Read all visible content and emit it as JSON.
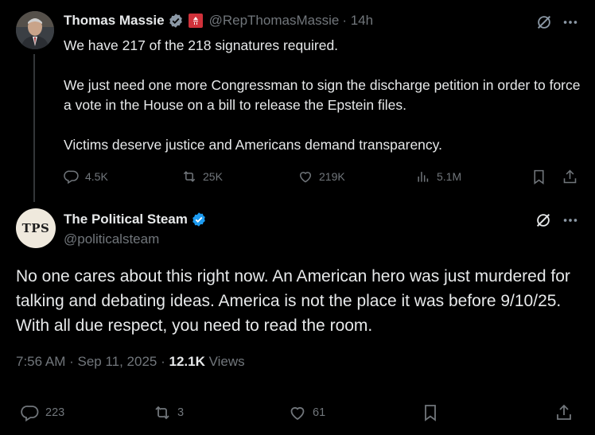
{
  "parent": {
    "display_name": "Thomas Massie",
    "handle": "@RepThomasMassie",
    "time": "· 14h",
    "paragraphs": [
      "We have 217 of the 218 signatures required.",
      "We just need one more Congressman to sign the discharge petition in order to force a vote in the House on a bill to release the Epstein files.",
      "Victims deserve justice and Americans demand transparency."
    ],
    "stats": {
      "replies": "4.5K",
      "reposts": "25K",
      "likes": "219K",
      "views": "5.1M"
    }
  },
  "reply": {
    "avatar_text": "TPS",
    "display_name": "The Political Steam",
    "handle": "@politicalsteam",
    "text": "No one cares about this right now. An American hero was just murdered for talking and debating ideas. America is not the place it was before 9/10/25. With all due respect, you need to read the room.",
    "timestamp": "7:56 AM · Sep 11, 2025 ·",
    "views_count": "12.1K",
    "views_label": "Views",
    "stats": {
      "replies": "223",
      "reposts": "3",
      "likes": "61"
    }
  },
  "icons": {
    "verified": "verified-badge-icon",
    "more": "more-icon",
    "grok": "grok-icon",
    "reply": "reply-icon",
    "repost": "repost-icon",
    "like": "like-icon",
    "views": "views-icon",
    "bookmark": "bookmark-icon",
    "share": "share-icon"
  },
  "colors": {
    "background": "#000000",
    "text": "#e7e9ea",
    "muted": "#71767b",
    "verified": "#1d9bf0",
    "flag": "#d0313a"
  }
}
